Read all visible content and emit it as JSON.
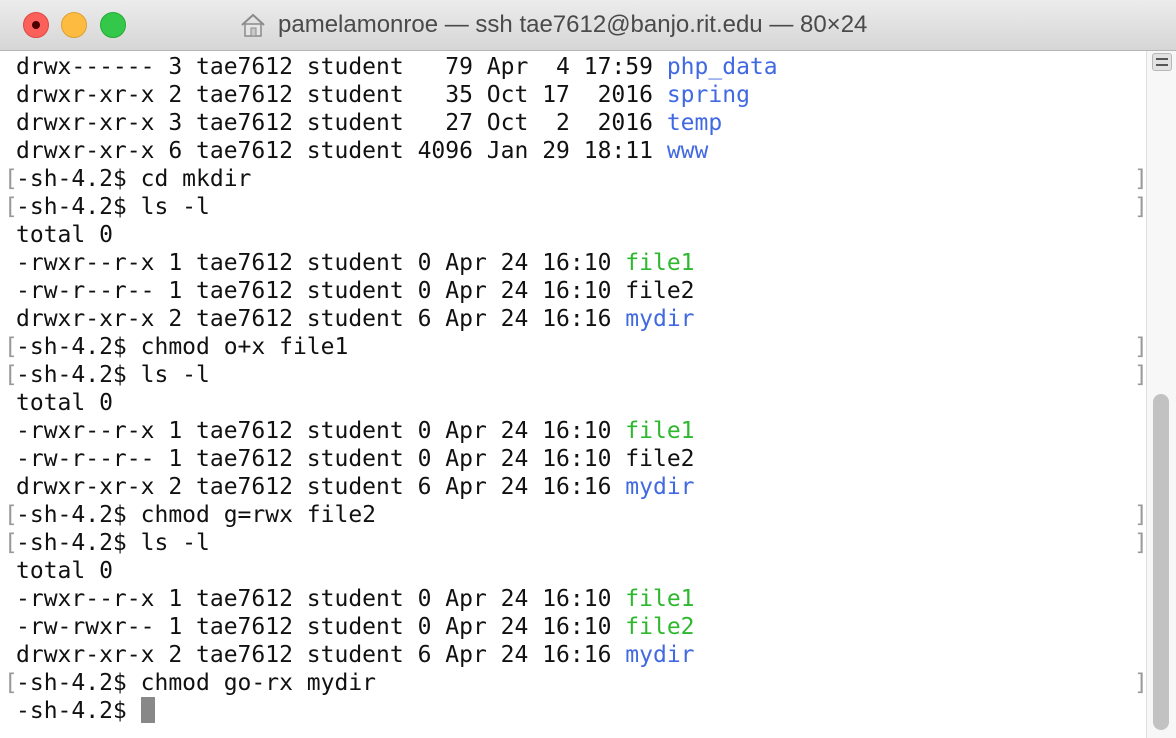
{
  "window": {
    "title": "pamelamonroe — ssh tae7612@banjo.rit.edu — 80×24"
  },
  "colors": {
    "directory": "#4169e1",
    "executable": "#2eb82e",
    "text": "#111111"
  },
  "terminal": {
    "lines": [
      {
        "pre": "drwx------ 3 tae7612 student   79 Apr  4 17:59 ",
        "name": "php_data",
        "type": "dir",
        "prompt": false
      },
      {
        "pre": "drwxr-xr-x 2 tae7612 student   35 Oct 17  2016 ",
        "name": "spring",
        "type": "dir",
        "prompt": false
      },
      {
        "pre": "drwxr-xr-x 3 tae7612 student   27 Oct  2  2016 ",
        "name": "temp",
        "type": "dir",
        "prompt": false
      },
      {
        "pre": "drwxr-xr-x 6 tae7612 student 4096 Jan 29 18:11 ",
        "name": "www",
        "type": "dir",
        "prompt": false
      },
      {
        "pre": "-sh-4.2$ cd mkdir",
        "name": "",
        "type": "",
        "prompt": true
      },
      {
        "pre": "-sh-4.2$ ls -l",
        "name": "",
        "type": "",
        "prompt": true
      },
      {
        "pre": "total 0",
        "name": "",
        "type": "",
        "prompt": false
      },
      {
        "pre": "-rwxr--r-x 1 tae7612 student 0 Apr 24 16:10 ",
        "name": "file1",
        "type": "exec",
        "prompt": false
      },
      {
        "pre": "-rw-r--r-- 1 tae7612 student 0 Apr 24 16:10 ",
        "name": "file2",
        "type": "plain",
        "prompt": false
      },
      {
        "pre": "drwxr-xr-x 2 tae7612 student 6 Apr 24 16:16 ",
        "name": "mydir",
        "type": "dir",
        "prompt": false
      },
      {
        "pre": "-sh-4.2$ chmod o+x file1",
        "name": "",
        "type": "",
        "prompt": true
      },
      {
        "pre": "-sh-4.2$ ls -l",
        "name": "",
        "type": "",
        "prompt": true
      },
      {
        "pre": "total 0",
        "name": "",
        "type": "",
        "prompt": false
      },
      {
        "pre": "-rwxr--r-x 1 tae7612 student 0 Apr 24 16:10 ",
        "name": "file1",
        "type": "exec",
        "prompt": false
      },
      {
        "pre": "-rw-r--r-- 1 tae7612 student 0 Apr 24 16:10 ",
        "name": "file2",
        "type": "plain",
        "prompt": false
      },
      {
        "pre": "drwxr-xr-x 2 tae7612 student 6 Apr 24 16:16 ",
        "name": "mydir",
        "type": "dir",
        "prompt": false
      },
      {
        "pre": "-sh-4.2$ chmod g=rwx file2",
        "name": "",
        "type": "",
        "prompt": true
      },
      {
        "pre": "-sh-4.2$ ls -l",
        "name": "",
        "type": "",
        "prompt": true
      },
      {
        "pre": "total 0",
        "name": "",
        "type": "",
        "prompt": false
      },
      {
        "pre": "-rwxr--r-x 1 tae7612 student 0 Apr 24 16:10 ",
        "name": "file1",
        "type": "exec",
        "prompt": false
      },
      {
        "pre": "-rw-rwxr-- 1 tae7612 student 0 Apr 24 16:10 ",
        "name": "file2",
        "type": "exec",
        "prompt": false
      },
      {
        "pre": "drwxr-xr-x 2 tae7612 student 6 Apr 24 16:16 ",
        "name": "mydir",
        "type": "dir",
        "prompt": false
      },
      {
        "pre": "-sh-4.2$ chmod go-rx mydir",
        "name": "",
        "type": "",
        "prompt": true
      }
    ],
    "current_prompt": "-sh-4.2$ "
  }
}
